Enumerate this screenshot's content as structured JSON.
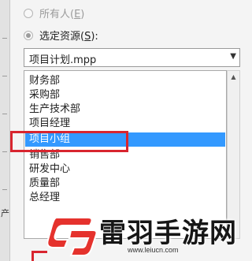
{
  "dialog": {
    "radio_all": {
      "label_pre": "所有人(",
      "accel": "E",
      "label_post": ")"
    },
    "radio_selected": {
      "label_pre": "选定资源(",
      "accel": "S",
      "label_post": "):"
    },
    "resource_select": {
      "value": "项目计划.mpp",
      "icon": "chevron-down-icon"
    },
    "resource_list": [
      {
        "label": "财务部"
      },
      {
        "label": "采购部"
      },
      {
        "label": "生产技术部"
      },
      {
        "label": "项目经理"
      },
      {
        "label": "项目小组",
        "selected": true
      },
      {
        "label": "销售部"
      },
      {
        "label": "研发中心"
      },
      {
        "label": "质量部"
      },
      {
        "label": "总经理"
      }
    ],
    "left_cut_glyph": "产"
  },
  "watermark": {
    "name": "雷羽手游网",
    "url": "www.leiucn.com"
  },
  "colors": {
    "selection": "#3399ff",
    "highlight_box": "#d8252f",
    "logo_red": "#e5322d"
  }
}
